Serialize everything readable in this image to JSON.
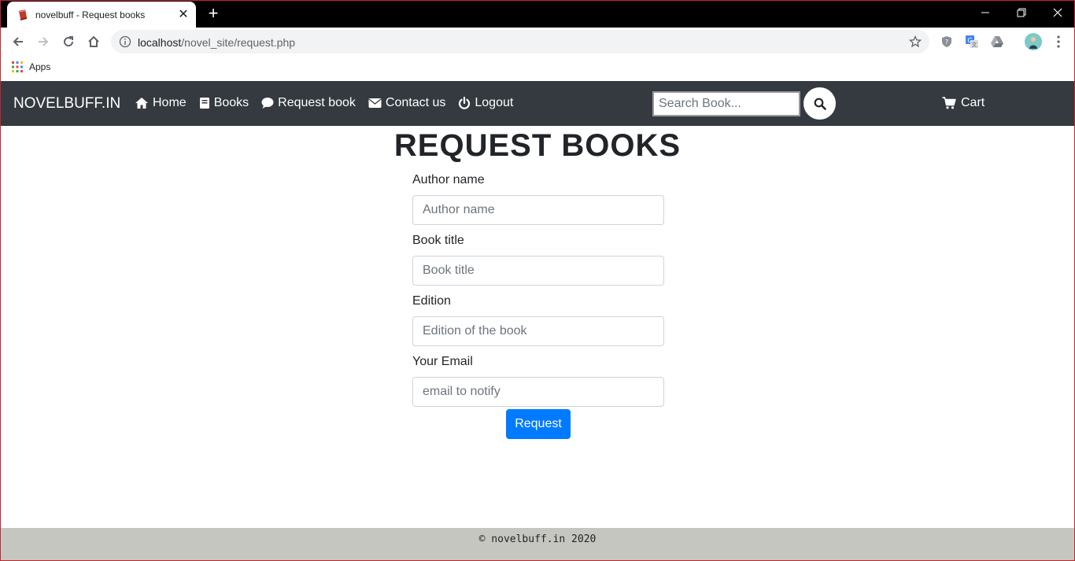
{
  "browser": {
    "tab_title": "novelbuff - Request books",
    "new_tab_symbol": "+",
    "close_symbol": "✕",
    "url_host": "localhost",
    "url_path": "/novel_site/request.php",
    "bookmarks": [
      {
        "label": "Apps"
      }
    ]
  },
  "navbar": {
    "brand": "NOVELBUFF.IN",
    "links": [
      {
        "label": "Home",
        "icon": "home-icon"
      },
      {
        "label": "Books",
        "icon": "book-icon"
      },
      {
        "label": "Request book",
        "icon": "comment-icon"
      },
      {
        "label": "Contact us",
        "icon": "envelope-icon"
      },
      {
        "label": "Logout",
        "icon": "power-icon"
      }
    ],
    "search_placeholder": "Search Book...",
    "cart_label": "Cart"
  },
  "main": {
    "title": "REQUEST BOOKS",
    "fields": [
      {
        "label": "Author name",
        "placeholder": "Author name"
      },
      {
        "label": "Book title",
        "placeholder": "Book title"
      },
      {
        "label": "Edition",
        "placeholder": "Edition of the book"
      },
      {
        "label": "Your Email",
        "placeholder": "email to notify"
      }
    ],
    "submit_label": "Request"
  },
  "footer": {
    "text": "© novelbuff.in 2020"
  },
  "colors": {
    "navbar_bg": "#343a40",
    "primary": "#007bff",
    "footer_bg": "#c6c6c0"
  }
}
